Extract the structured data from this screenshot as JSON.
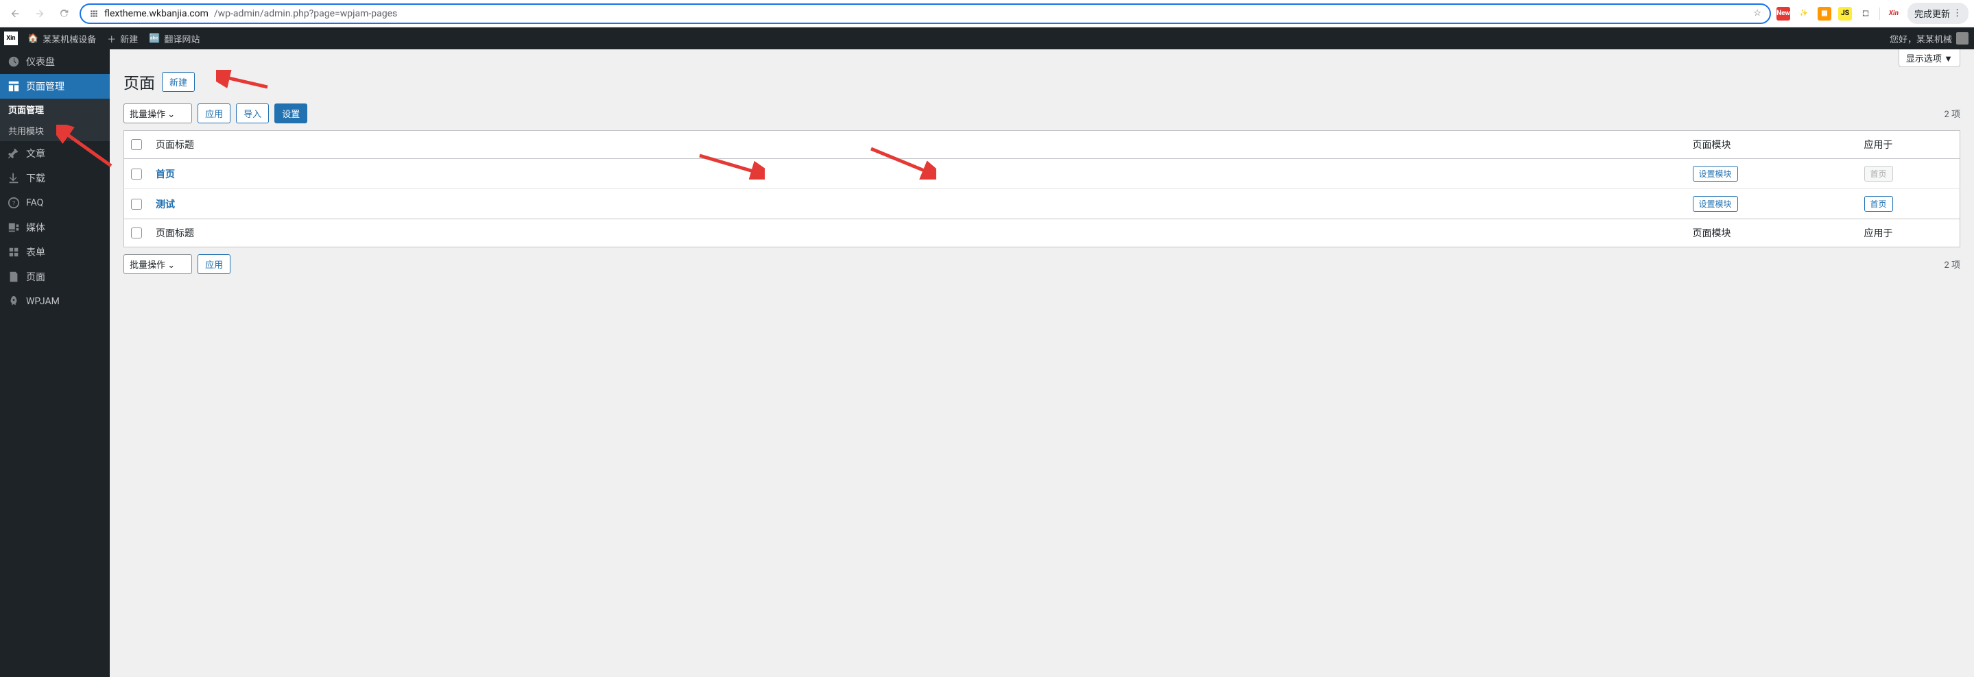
{
  "browser": {
    "url_domain": "flextheme.wkbanjia.com",
    "url_path": "/wp-admin/admin.php?page=wpjam-pages",
    "update_label": "完成更新"
  },
  "admin_bar": {
    "site_name": "某某机械设备",
    "new_label": "新建",
    "translate_label": "翻译网站",
    "greeting": "您好，某某机械"
  },
  "sidebar": {
    "items": [
      {
        "label": "仪表盘",
        "icon": "dashboard"
      },
      {
        "label": "页面管理",
        "icon": "layout",
        "current": true
      },
      {
        "label": "文章",
        "icon": "pin"
      },
      {
        "label": "下载",
        "icon": "download"
      },
      {
        "label": "FAQ",
        "icon": "help"
      },
      {
        "label": "媒体",
        "icon": "media"
      },
      {
        "label": "表单",
        "icon": "form"
      },
      {
        "label": "页面",
        "icon": "page"
      },
      {
        "label": "WPJAM",
        "icon": "rocket"
      }
    ],
    "submenu": [
      {
        "label": "页面管理",
        "active": true
      },
      {
        "label": "共用模块"
      }
    ]
  },
  "content": {
    "screen_options": "显示选项",
    "page_title": "页面",
    "new_btn": "新建",
    "bulk_action": "批量操作",
    "apply_btn": "应用",
    "import_btn": "导入",
    "settings_btn": "设置",
    "item_count": "2 项",
    "columns": {
      "title": "页面标题",
      "module": "页面模块",
      "apply": "应用于"
    },
    "rows": [
      {
        "title": "首页",
        "module_btn": "设置模块",
        "apply_label": "首页",
        "apply_disabled": true
      },
      {
        "title": "测试",
        "module_btn": "设置模块",
        "apply_label": "首页",
        "apply_disabled": false
      }
    ]
  }
}
